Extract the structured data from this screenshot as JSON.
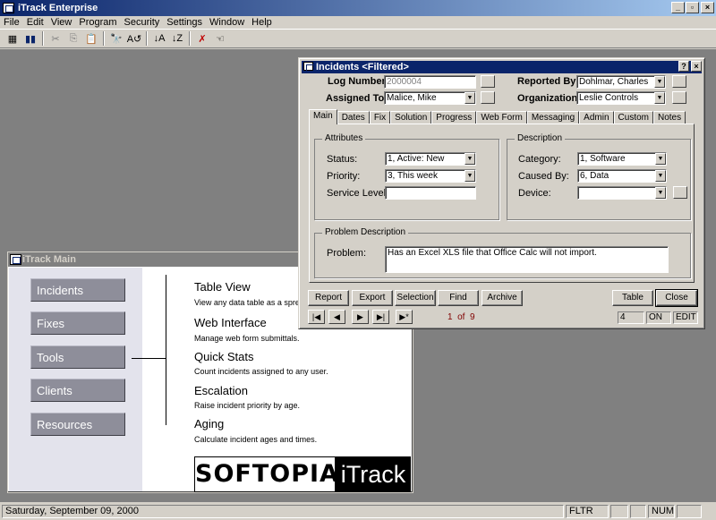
{
  "app": {
    "title": "iTrack Enterprise"
  },
  "menu": [
    "File",
    "Edit",
    "View",
    "Program",
    "Security",
    "Settings",
    "Window",
    "Help"
  ],
  "status": {
    "date": "Saturday, September 09, 2000",
    "fltr": "FLTR",
    "num": "NUM"
  },
  "main": {
    "title": "iTrack Main",
    "nav": [
      "Incidents",
      "Fixes",
      "Tools",
      "Clients",
      "Resources"
    ],
    "items": [
      {
        "title": "Table View",
        "desc": "View any data table as a spread"
      },
      {
        "title": "Web Interface",
        "desc": "Manage web form submittals."
      },
      {
        "title": "Quick Stats",
        "desc": "Count incidents assigned to any user."
      },
      {
        "title": "Escalation",
        "desc": "Raise incident priority by age."
      },
      {
        "title": "Aging",
        "desc": "Calculate incident ages and times."
      }
    ],
    "logo_left": "SOFTOPIA",
    "logo_right": "iTrack"
  },
  "inc": {
    "title": "Incidents <Filtered>",
    "log_label": "Log Number:",
    "log_value": "2000004",
    "assigned_label": "Assigned To:",
    "assigned_value": "Malice, Mike",
    "reported_label": "Reported By:",
    "reported_value": "Dohlmar, Charles",
    "org_label": "Organization:",
    "org_value": "Leslie Controls",
    "tabs": [
      "Main",
      "Dates",
      "Fix",
      "Solution",
      "Progress",
      "Web Form",
      "Messaging",
      "Admin",
      "Custom",
      "Notes"
    ],
    "attributes_label": "Attributes",
    "status_label": "Status:",
    "status_value": "1, Active: New",
    "priority_label": "Priority:",
    "priority_value": "3, This week",
    "service_label": "Service Level:",
    "service_value": "",
    "description_label": "Description",
    "category_label": "Category:",
    "category_value": "1, Software",
    "caused_label": "Caused By:",
    "caused_value": "6, Data",
    "device_label": "Device:",
    "device_value": "",
    "problem_group": "Problem Description",
    "problem_label": "Problem:",
    "problem_value": "Has an Excel XLS file that Office Calc will not import.",
    "buttons": {
      "report": "Report",
      "export": "Export",
      "selection": "Selection",
      "find": "Find",
      "archive": "Archive",
      "table": "Table",
      "close": "Close"
    },
    "record": "1  of  9",
    "rec_box": "4",
    "on_box": "ON",
    "edit_box": "EDIT"
  }
}
